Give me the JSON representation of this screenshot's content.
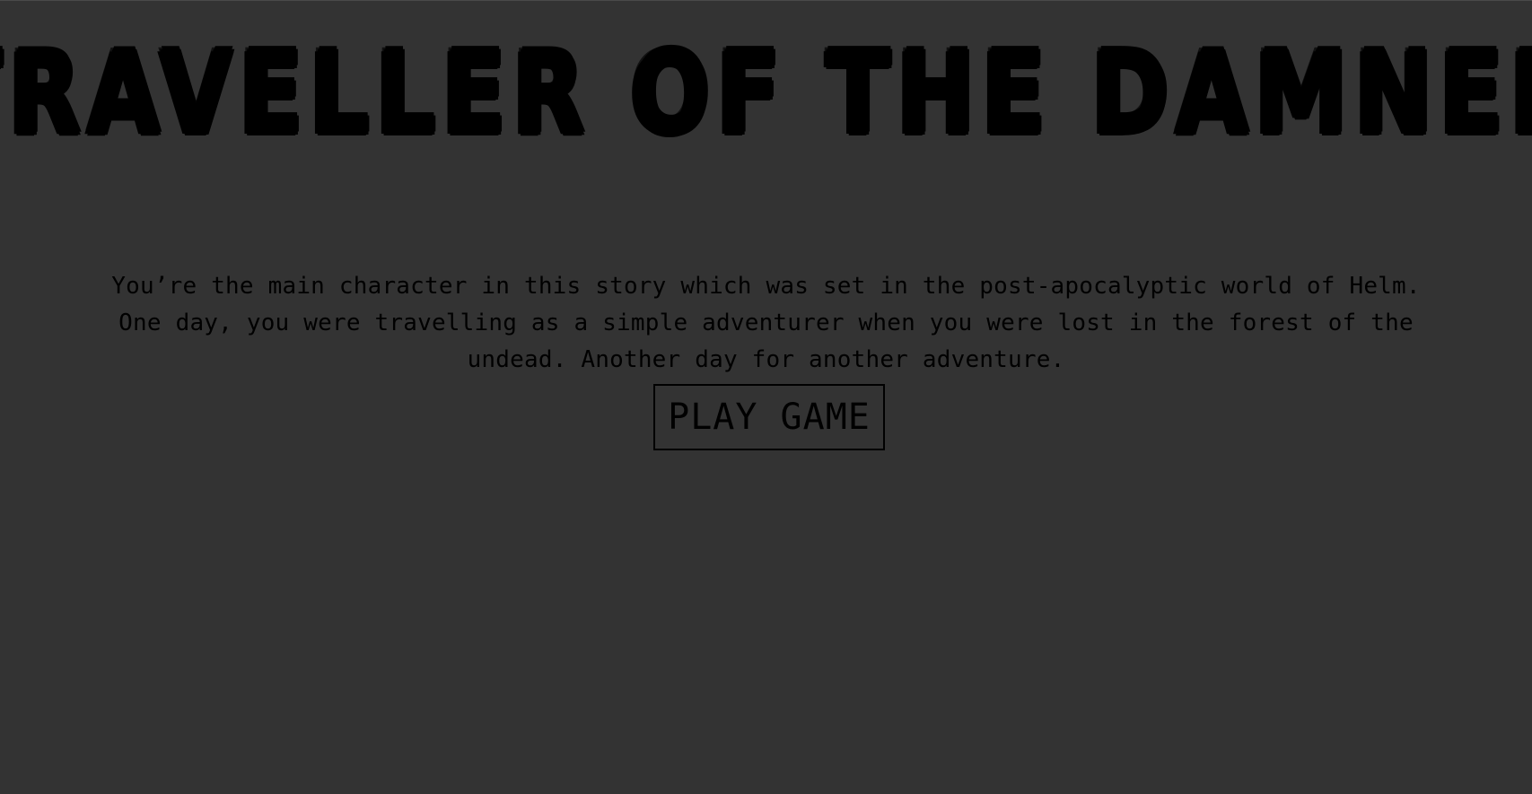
{
  "game": {
    "title": "Traveller of the Damned"
  },
  "intro": {
    "text": "You’re the main character in this story which was set in the post-apocalyptic world of Helm. One day, you were travelling as a simple adventurer when you were lost in the forest of the undead. Another day for another adventure."
  },
  "menu": {
    "play_label": "Play Game"
  },
  "colors": {
    "background": "#333333",
    "text": "#000000",
    "button_border": "#000000"
  }
}
